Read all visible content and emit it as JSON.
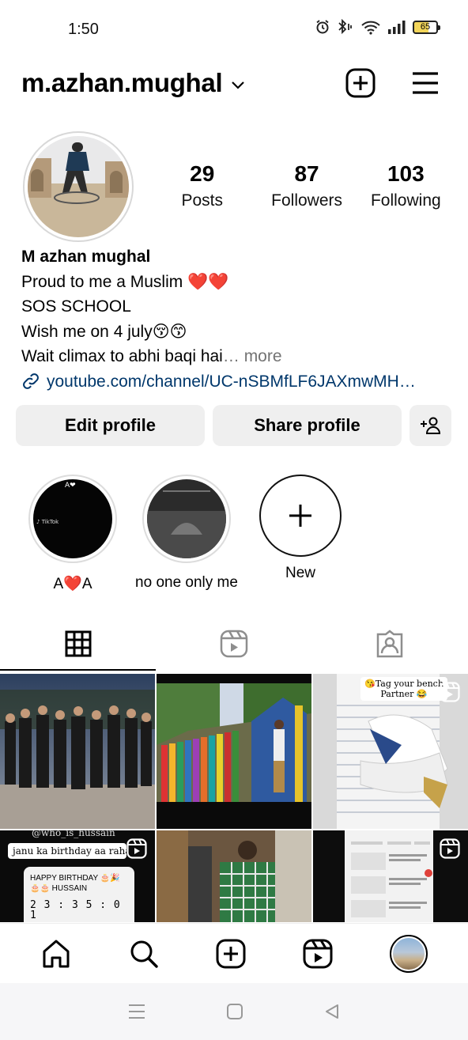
{
  "status_bar": {
    "time": "1:50",
    "battery": "65"
  },
  "header": {
    "username": "m.azhan.mughal"
  },
  "profile": {
    "stats": [
      {
        "num": "29",
        "label": "Posts"
      },
      {
        "num": "87",
        "label": "Followers"
      },
      {
        "num": "103",
        "label": "Following"
      }
    ],
    "name": "M azhan mughal",
    "bio_line1": "Proud to me a Muslim ❤️❤️",
    "bio_line2": "SOS SCHOOL",
    "bio_line3": "Wish me on 4  july😚😙",
    "bio_line4": "Wait climax to abhi baqi hai",
    "bio_ellipsis": "… ",
    "more": "more",
    "link": "youtube.com/channel/UC-nSBMfLF6JAXmwMH…"
  },
  "buttons": {
    "edit": "Edit profile",
    "share": "Share profile"
  },
  "highlights": [
    {
      "label": "A❤️A"
    },
    {
      "label": "no one only me"
    },
    {
      "label": "New"
    }
  ],
  "grid_texts": {
    "tag_bench": "😘Tag your bench Partner 😂",
    "who_is": "@who_is_hussain",
    "birthday_caption": "janu ka birthday aa raha",
    "happy_birthday": "HAPPY BIRTHDAY 🎂🎉",
    "hussain": "🎂🎂 HUSSAIN",
    "countdown": "2 3 : 3 5 : 0 1"
  },
  "colors": {
    "link": "#00376b",
    "button_bg": "#efefef",
    "muted": "#737373"
  }
}
